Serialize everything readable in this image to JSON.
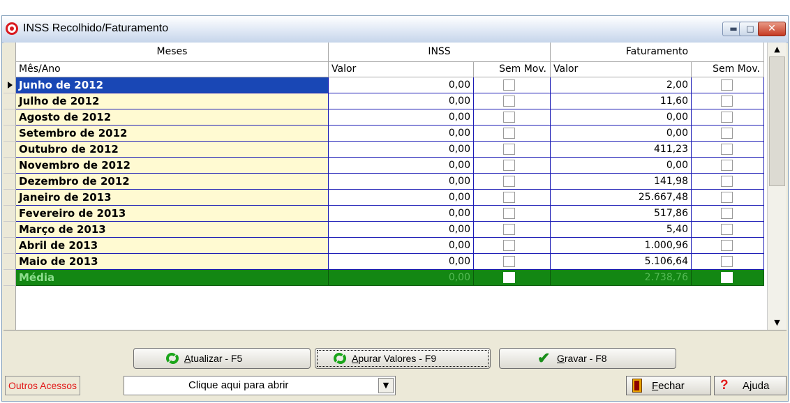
{
  "window": {
    "title": "INSS Recolhido/Faturamento",
    "controls": {
      "minimize": "▬",
      "maximize": "□",
      "close": "✕"
    }
  },
  "grid": {
    "group_headers": {
      "meses": "Meses",
      "inss": "INSS",
      "faturamento": "Faturamento"
    },
    "sub_headers": {
      "mes_ano": "Mês/Ano",
      "inss_valor": "Valor",
      "inss_sem_mov": "Sem Mov.",
      "fat_valor": "Valor",
      "fat_sem_mov": "Sem Mov."
    },
    "rows": [
      {
        "mes": "Junho de 2012",
        "inss": "0,00",
        "fat": "2,00"
      },
      {
        "mes": "Julho de 2012",
        "inss": "0,00",
        "fat": "11,60"
      },
      {
        "mes": "Agosto de 2012",
        "inss": "0,00",
        "fat": "0,00"
      },
      {
        "mes": "Setembro de 2012",
        "inss": "0,00",
        "fat": "0,00"
      },
      {
        "mes": "Outubro de 2012",
        "inss": "0,00",
        "fat": "411,23"
      },
      {
        "mes": "Novembro de 2012",
        "inss": "0,00",
        "fat": "0,00"
      },
      {
        "mes": "Dezembro de 2012",
        "inss": "0,00",
        "fat": "141,98"
      },
      {
        "mes": "Janeiro de 2013",
        "inss": "0,00",
        "fat": "25.667,48"
      },
      {
        "mes": "Fevereiro de 2013",
        "inss": "0,00",
        "fat": "517,86"
      },
      {
        "mes": "Março de 2013",
        "inss": "0,00",
        "fat": "5,40"
      },
      {
        "mes": "Abril de 2013",
        "inss": "0,00",
        "fat": "1.000,96"
      },
      {
        "mes": "Maio de 2013",
        "inss": "0,00",
        "fat": "5.106,64"
      }
    ],
    "media": {
      "mes": "Média",
      "inss": "0,00",
      "fat": "2.738,76"
    },
    "colors": {
      "selected": "#1947b5",
      "media": "#138713",
      "mes_bg": "#fffad2"
    }
  },
  "buttons": {
    "atualizar": {
      "accel": "A",
      "rest": "tualizar - F5"
    },
    "apurar": {
      "accel": "A",
      "rest": "purar Valores - F9"
    },
    "gravar": {
      "accel": "G",
      "rest": "ravar - F8"
    }
  },
  "bottom": {
    "outros_acessos": "Outros Acessos",
    "combo_text": "Clique aqui para abrir",
    "fechar": {
      "accel": "F",
      "rest": "echar"
    },
    "ajuda": "Ajuda"
  }
}
